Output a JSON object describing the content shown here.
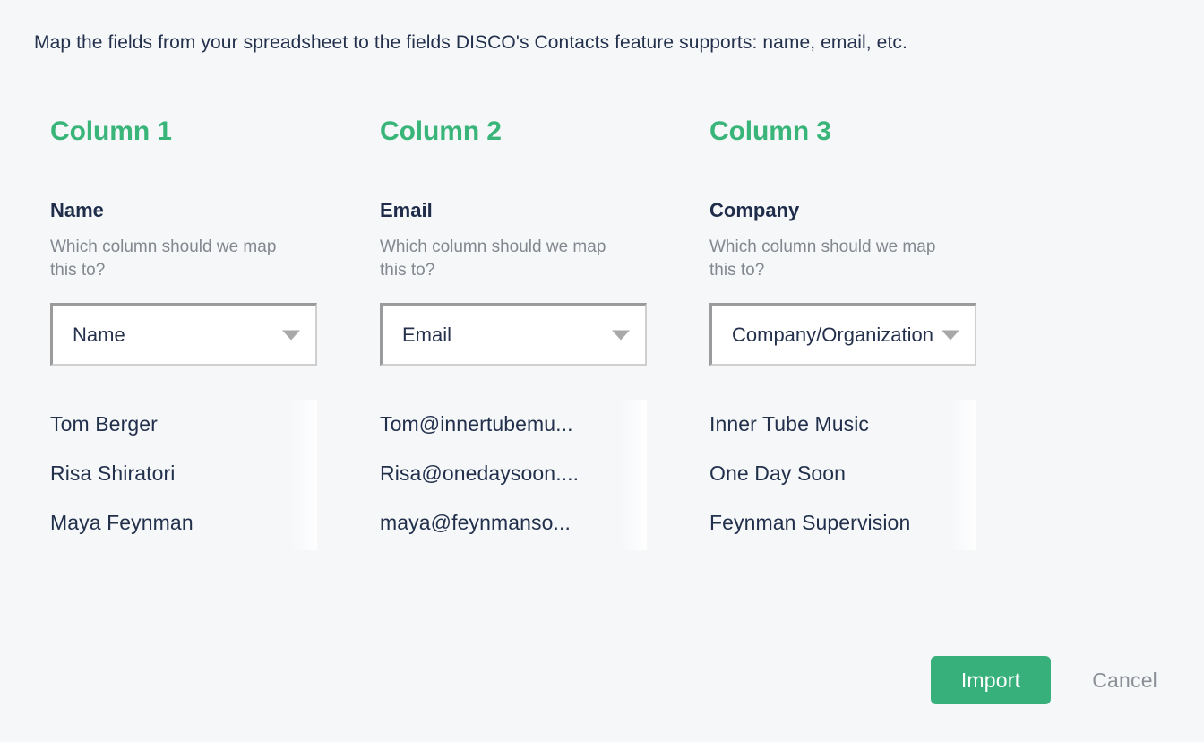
{
  "instruction": "Map the fields from your spreadsheet to the fields DISCO's Contacts feature supports: name, email, etc.",
  "colors": {
    "accent_green": "#3ab57a",
    "button_green": "#37b07b",
    "heading_navy": "#1f2d4a",
    "muted_gray": "#83888f",
    "background": "#f5f7f9"
  },
  "columns": [
    {
      "title": "Column 1",
      "field_label": "Name",
      "question": "Which column should we map this to?",
      "select_value": "Name",
      "arrow_icon": "chevron-down-icon",
      "preview": [
        "Tom Berger",
        "Risa Shiratori",
        "Maya Feynman"
      ]
    },
    {
      "title": "Column 2",
      "field_label": "Email",
      "question": "Which column should we map this to?",
      "select_value": "Email",
      "arrow_icon": "chevron-down-icon",
      "preview": [
        "Tom@innertubemu...",
        "Risa@onedaysoon....",
        "maya@feynmanso..."
      ]
    },
    {
      "title": "Column 3",
      "field_label": "Company",
      "question": "Which column should we map this to?",
      "select_value": "Company/Organization",
      "arrow_icon": "chevron-down-icon",
      "preview": [
        "Inner Tube Music",
        "One Day Soon",
        "Feynman Supervision"
      ]
    }
  ],
  "actions": {
    "import_label": "Import",
    "cancel_label": "Cancel"
  }
}
